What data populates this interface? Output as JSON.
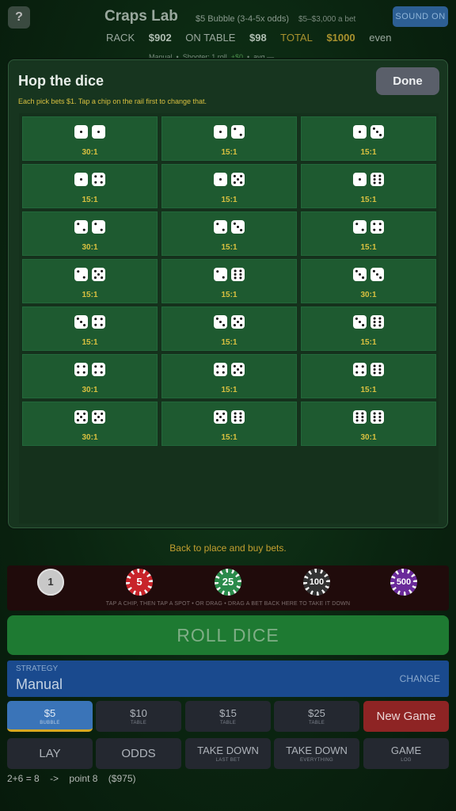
{
  "header": {
    "help_label": "?",
    "title": "Craps Lab",
    "table_rule": "$5 Bubble (3-4-5x odds)",
    "bet_range": "$5–$3,000 a bet",
    "sound_label": "SOUND ON",
    "rack_label": "RACK",
    "rack_value": "$902",
    "on_table_label": "ON TABLE",
    "on_table_value": "$98",
    "total_label": "TOTAL",
    "total_value": "$1000",
    "even_label": "even",
    "sub_status": {
      "mode": "Manual",
      "shooter": "Shooter: 1 roll,",
      "shooter_delta": "+$0",
      "avg": "avg —"
    }
  },
  "modal": {
    "title": "Hop the dice",
    "done_label": "Done",
    "note": "Each pick bets $1. Tap a chip on the rail first to change that.",
    "hops": [
      {
        "d1": 1,
        "d2": 1,
        "odds": "30:1"
      },
      {
        "d1": 1,
        "d2": 2,
        "odds": "15:1"
      },
      {
        "d1": 1,
        "d2": 3,
        "odds": "15:1"
      },
      {
        "d1": 1,
        "d2": 4,
        "odds": "15:1"
      },
      {
        "d1": 1,
        "d2": 5,
        "odds": "15:1"
      },
      {
        "d1": 1,
        "d2": 6,
        "odds": "15:1"
      },
      {
        "d1": 2,
        "d2": 2,
        "odds": "30:1"
      },
      {
        "d1": 2,
        "d2": 3,
        "odds": "15:1"
      },
      {
        "d1": 2,
        "d2": 4,
        "odds": "15:1"
      },
      {
        "d1": 2,
        "d2": 5,
        "odds": "15:1"
      },
      {
        "d1": 2,
        "d2": 6,
        "odds": "15:1"
      },
      {
        "d1": 3,
        "d2": 3,
        "odds": "30:1"
      },
      {
        "d1": 3,
        "d2": 4,
        "odds": "15:1"
      },
      {
        "d1": 3,
        "d2": 5,
        "odds": "15:1"
      },
      {
        "d1": 3,
        "d2": 6,
        "odds": "15:1"
      },
      {
        "d1": 4,
        "d2": 4,
        "odds": "30:1"
      },
      {
        "d1": 4,
        "d2": 5,
        "odds": "15:1"
      },
      {
        "d1": 4,
        "d2": 6,
        "odds": "15:1"
      },
      {
        "d1": 5,
        "d2": 5,
        "odds": "30:1"
      },
      {
        "d1": 5,
        "d2": 6,
        "odds": "15:1"
      },
      {
        "d1": 6,
        "d2": 6,
        "odds": "30:1"
      }
    ]
  },
  "back_message": "Back to place and buy bets.",
  "rail": {
    "chips": [
      {
        "label": "1",
        "color": "#c8c8c8",
        "text_color": "#333333"
      },
      {
        "label": "5",
        "color": "#c8242a",
        "text_color": "#ffffff"
      },
      {
        "label": "25",
        "color": "#2a8a4a",
        "text_color": "#ffffff"
      },
      {
        "label": "100",
        "color": "#333333",
        "text_color": "#ffffff"
      },
      {
        "label": "500",
        "color": "#6a2a9a",
        "text_color": "#ffffff"
      }
    ],
    "hint": "TAP A CHIP, THEN TAP A SPOT  •  OR DRAG  •  DRAG A BET BACK HERE TO TAKE IT DOWN"
  },
  "roll_label": "ROLL  DICE",
  "strategy": {
    "label": "STRATEGY",
    "value": "Manual",
    "change_label": "CHANGE"
  },
  "tables": [
    {
      "main": "$5",
      "sub": "BUBBLE"
    },
    {
      "main": "$10",
      "sub": "TABLE"
    },
    {
      "main": "$15",
      "sub": "TABLE"
    },
    {
      "main": "$25",
      "sub": "TABLE"
    }
  ],
  "new_game_label": "New Game",
  "actions": {
    "lay": "LAY",
    "odds": "ODDS",
    "take_down_last": {
      "main": "TAKE DOWN",
      "sub": "LAST BET"
    },
    "take_down_all": {
      "main": "TAKE DOWN",
      "sub": "EVERYTHING"
    },
    "game_log": {
      "main": "GAME",
      "sub": "LOG"
    }
  },
  "status_line": {
    "roll": "2+6 = 8",
    "arrow": "->",
    "result": "point 8",
    "bankroll": "($975)"
  }
}
